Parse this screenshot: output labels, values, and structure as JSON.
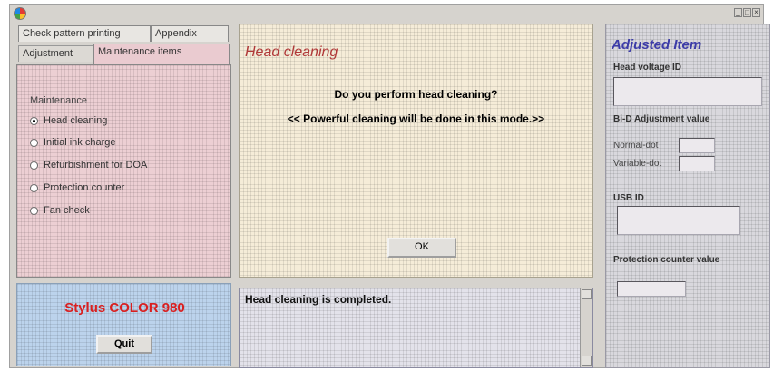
{
  "window": {
    "minimize_glyph": "_",
    "maximize_glyph": "□",
    "close_glyph": "×"
  },
  "tabs": {
    "back_row": [
      "Check pattern printing",
      "Appendix"
    ],
    "front_row": {
      "adjustment": "Adjustment",
      "maintenance": "Maintenance items"
    }
  },
  "maintenance": {
    "label": "Maintenance",
    "options": [
      "Head cleaning",
      "Initial ink charge",
      "Refurbishment for DOA",
      "Protection counter",
      "Fan check"
    ],
    "selected": "Head cleaning"
  },
  "model": {
    "name": "Stylus COLOR 980",
    "quit_label": "Quit"
  },
  "main": {
    "title": "Head cleaning",
    "question": "Do you perform head cleaning?",
    "note": "<< Powerful cleaning will be done in this mode.>>",
    "ok_label": "OK"
  },
  "log": {
    "message": "Head cleaning is completed."
  },
  "adjusted": {
    "title": "Adjusted Item",
    "head_voltage_label": "Head voltage ID",
    "bi_d_label": "Bi-D Adjustment value",
    "normal_dot": "Normal-dot",
    "variable_dot": "Variable-dot",
    "usb_label": "USB ID",
    "protection_label": "Protection counter value"
  },
  "colors": {
    "model_name": "#d92020",
    "main_title": "#b03838",
    "adjusted_title": "#3c3ca8"
  }
}
